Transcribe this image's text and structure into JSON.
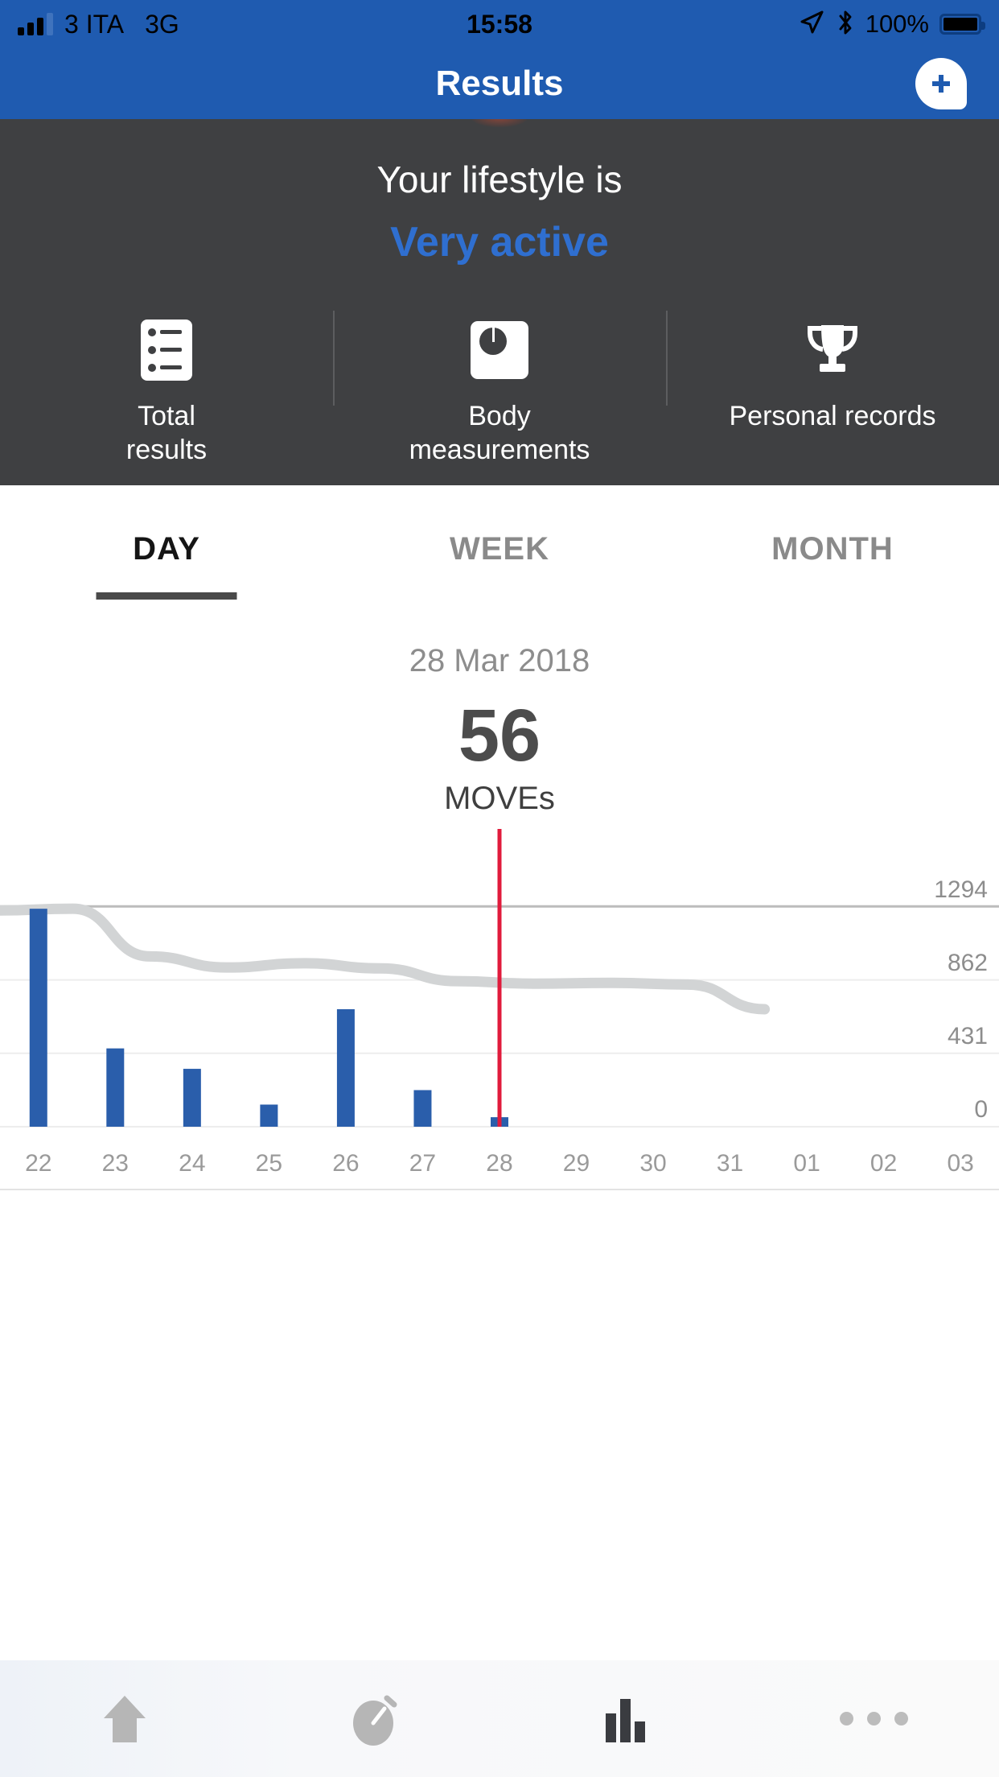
{
  "status_bar": {
    "carrier": "3 ITA",
    "network": "3G",
    "time": "15:58",
    "battery_percent": "100%",
    "signal_bars_filled": 3,
    "signal_bars_total": 4,
    "location_icon": "location-arrow-icon",
    "bluetooth_icon": "bluetooth-icon",
    "battery_icon": "battery-full-icon"
  },
  "nav_bar": {
    "title": "Results",
    "add_icon": "plus-icon",
    "background_color": "#1f5bb0"
  },
  "hero": {
    "lifestyle_prefix": "Your lifestyle is",
    "lifestyle_value": "Very active",
    "lifestyle_value_color": "#2f6fd0",
    "background_color": "#3f4042",
    "shortcuts": [
      {
        "label": "Total\nresults",
        "label_line1": "Total",
        "label_line2": "results",
        "icon": "list-icon"
      },
      {
        "label": "Body\nmeasurements",
        "label_line1": "Body",
        "label_line2": "measurements",
        "icon": "scale-icon"
      },
      {
        "label": "Personal records",
        "label_line1": "Personal records",
        "label_line2": "",
        "icon": "trophy-icon"
      }
    ]
  },
  "tabs": [
    {
      "label": "DAY",
      "active": true
    },
    {
      "label": "WEEK",
      "active": false
    },
    {
      "label": "MONTH",
      "active": false
    }
  ],
  "summary": {
    "date": "28 Mar 2018",
    "value": "56",
    "unit": "MOVEs"
  },
  "chart_data": {
    "type": "bar",
    "title": "",
    "xlabel": "",
    "ylabel": "",
    "categories": [
      "22",
      "23",
      "24",
      "25",
      "26",
      "27",
      "28",
      "29",
      "30",
      "31",
      "01",
      "02",
      "03"
    ],
    "values": [
      1280,
      460,
      340,
      130,
      690,
      215,
      56,
      0,
      0,
      0,
      0,
      0,
      0
    ],
    "series": [
      {
        "name": "MOVEs",
        "type": "bar",
        "color": "#2a5eab",
        "values": [
          1280,
          460,
          340,
          130,
          690,
          215,
          56,
          0,
          0,
          0,
          0,
          0,
          0
        ]
      },
      {
        "name": "Trend",
        "type": "line",
        "color": "#d2d4d5",
        "values": [
          1270,
          1280,
          1000,
          935,
          960,
          930,
          855,
          840,
          845,
          835,
          690,
          null,
          null
        ]
      }
    ],
    "ytick_labels": [
      "0",
      "431",
      "862",
      "1294"
    ],
    "ytick_values": [
      0,
      431,
      862,
      1294
    ],
    "ylim": [
      0,
      1725
    ],
    "grid": true,
    "legend": "none",
    "highlight": {
      "category": "28",
      "color": "#e01b3c",
      "label": "selected-day-marker"
    }
  },
  "bottom_nav": [
    {
      "icon": "home-icon",
      "active": false
    },
    {
      "icon": "stopwatch-icon",
      "active": false
    },
    {
      "icon": "bar-chart-icon",
      "active": true
    },
    {
      "icon": "more-icon",
      "active": false
    }
  ]
}
